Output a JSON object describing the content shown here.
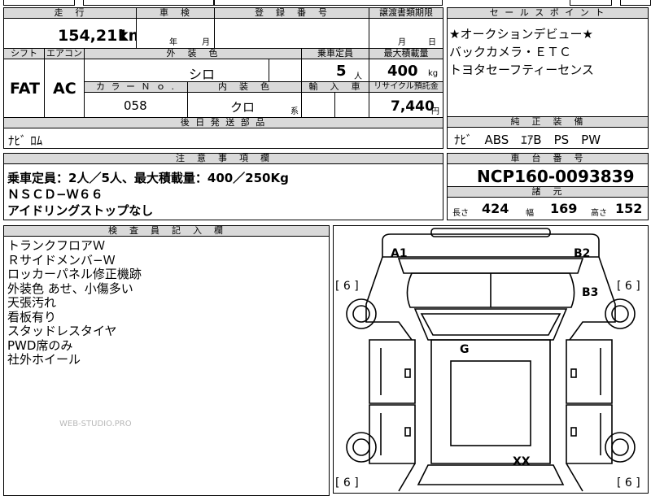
{
  "header": {
    "mileage": "走　行",
    "inspection": "車　検",
    "registration": "登　録　番　号",
    "transfer_deadline": "譲渡書類期限",
    "sales_points": "セ ー ル ス ポ イ ン ト",
    "shift": "シフト",
    "aircon": "エアコン",
    "exterior_color": "外　装　色",
    "capacity": "乗車定員",
    "max_load": "最大積載量",
    "color_no": "カ ラ ー Ｎ ｏ .",
    "interior_color": "内　装　色",
    "import": "輸　入　車",
    "recycle": "リサイクル預託金",
    "later_parts": "後 日 発 送 部 品",
    "genuine_equipment": "純　正　装　備",
    "notes": "注　意　事　項　欄",
    "chassis_no": "車　台　番　号",
    "specs": "諸　元",
    "inspector_notes": "検　査　員　記　入　欄"
  },
  "vehicle": {
    "mileage_value": "154,211",
    "mileage_unit": "km",
    "inspection_year": "年",
    "inspection_month": "月",
    "transfer_month": "月",
    "transfer_day": "日",
    "shift": "FAT",
    "aircon": "AC",
    "exterior_color": "シロ",
    "capacity_value": "5",
    "capacity_unit": "人",
    "max_load_value": "400",
    "max_load_unit": "kg",
    "color_no": "058",
    "interior_color": "クロ",
    "interior_suffix": "系",
    "recycle_value": "7,440",
    "recycle_unit": "円",
    "later_parts": "ﾅﾋﾞ ﾛﾑ",
    "genuine_equipment": "ﾅﾋﾞ　ABS　ｴｱB　PS　PW",
    "chassis_no": "NCP160-0093839",
    "length_label": "長さ",
    "length_value": "424",
    "width_label": "幅",
    "width_value": "169",
    "height_label": "高さ",
    "height_value": "152"
  },
  "sales_points": [
    "★オークションデビュー★",
    "バックカメラ・ＥＴＣ",
    "トヨタセーフティーセンス"
  ],
  "notes": [
    "乗車定員：2人／5人、最大積載量：400／250Kg",
    "ＮＳＣＤ−Ｗ６６",
    "アイドリングストップなし"
  ],
  "inspector_notes": [
    "トランクフロアＷ",
    "Ｒサイドメンバ−Ｗ",
    "ロッカーパネル修正機跡",
    "外装色 あせ、小傷多い",
    "天張汚れ",
    "看板有り",
    "スタッドレスタイヤ",
    "PWD席のみ",
    "社外ホイール"
  ],
  "watermark": "WEB-STUDIO.PRO",
  "diagram": {
    "marks": {
      "a1": "A1",
      "b2": "B2",
      "b3": "B3",
      "g": "G",
      "xx": "XX"
    },
    "tire_fl": "[ 6 ]",
    "tire_fr": "[ 6 ]",
    "tire_rl": "[ 6 ]",
    "tire_rr": "[ 6 ]"
  }
}
